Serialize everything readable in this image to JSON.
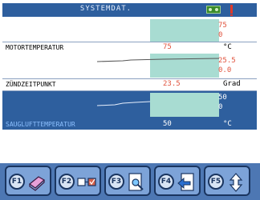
{
  "header": {
    "title": "SYSTEMDAT."
  },
  "graphs": [
    {
      "max": "75",
      "min": "0"
    },
    {
      "max": "25.5",
      "min": "0.0"
    },
    {
      "max": "50",
      "min": "0"
    }
  ],
  "rows": [
    {
      "label": "MOTORTEMPERATUR",
      "value": "75",
      "unit": "°C"
    },
    {
      "label": "ZÜNDZEITPUNKT",
      "value": "23.5",
      "unit": "Grad"
    },
    {
      "label": "SAUGLUFTTEMPERATUR",
      "value": "50",
      "unit": "°C"
    }
  ],
  "function_keys": [
    {
      "label": "F1",
      "icon": "book-icon"
    },
    {
      "label": "F2",
      "icon": "toggle-icon"
    },
    {
      "label": "F3",
      "icon": "magnify-document-icon"
    },
    {
      "label": "F4",
      "icon": "back-arrow-document-icon"
    },
    {
      "label": "F5",
      "icon": "up-down-arrows-icon"
    }
  ],
  "colors": {
    "header": "#2e5f9e",
    "highlight": "#a8dcd2",
    "value": "#e0533e",
    "fbar": "#4d77b3"
  }
}
